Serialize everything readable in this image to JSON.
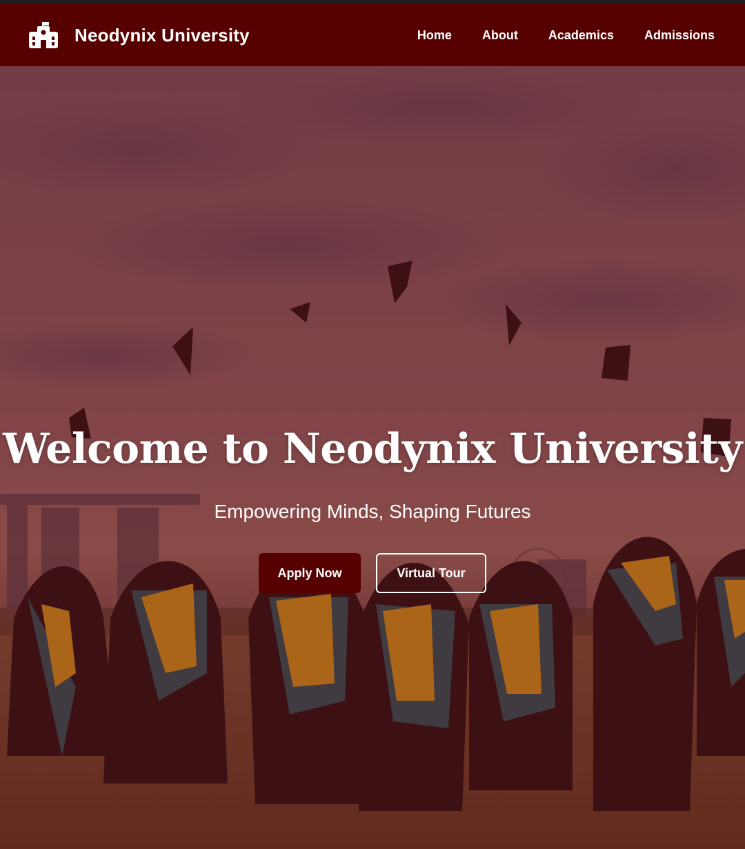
{
  "header": {
    "university_name": "Neodynix University",
    "logo_icon": "school-building-icon",
    "bar_color": "#560000"
  },
  "nav": {
    "items": [
      {
        "label": "Home"
      },
      {
        "label": "About"
      },
      {
        "label": "Academics"
      },
      {
        "label": "Admissions"
      }
    ]
  },
  "hero": {
    "title": "Welcome to Neodynix University",
    "subtitle": "Empowering Minds, Shaping Futures",
    "primary_button": "Apply Now",
    "secondary_button": "Virtual Tour",
    "overlay_color": "#7a1f24",
    "image_subject": "graduates-throwing-caps-photo"
  }
}
